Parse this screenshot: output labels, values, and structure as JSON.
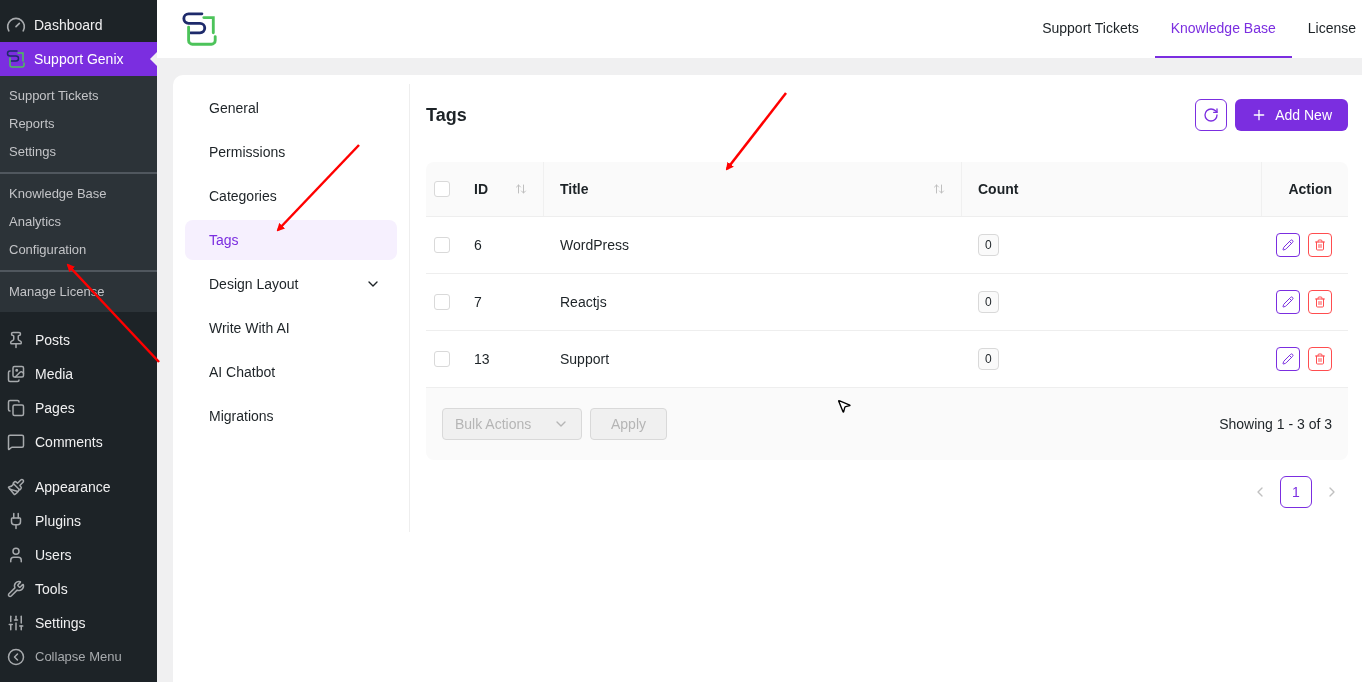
{
  "sidebar": {
    "top": [
      {
        "label": "Dashboard",
        "selected": false
      },
      {
        "label": "Support Genix",
        "selected": true
      }
    ],
    "submenu_groups": [
      [
        {
          "label": "Support Tickets"
        },
        {
          "label": "Reports"
        },
        {
          "label": "Settings"
        }
      ],
      [
        {
          "label": "Knowledge Base"
        },
        {
          "label": "Analytics"
        },
        {
          "label": "Configuration"
        }
      ],
      [
        {
          "label": "Manage License"
        }
      ]
    ],
    "menu_groups": [
      [
        {
          "label": "Posts"
        },
        {
          "label": "Media"
        },
        {
          "label": "Pages"
        },
        {
          "label": "Comments"
        }
      ],
      [
        {
          "label": "Appearance"
        },
        {
          "label": "Plugins"
        },
        {
          "label": "Users"
        },
        {
          "label": "Tools"
        },
        {
          "label": "Settings"
        }
      ]
    ],
    "collapse": "Collapse Menu"
  },
  "header": {
    "tabs": [
      {
        "label": "Support Tickets",
        "selected": false
      },
      {
        "label": "Knowledge Base",
        "selected": true
      },
      {
        "label": "License",
        "selected": false
      }
    ]
  },
  "settings_nav": [
    {
      "label": "General",
      "selected": false,
      "kind": "link"
    },
    {
      "label": "Permissions",
      "selected": false,
      "kind": "link"
    },
    {
      "label": "Categories",
      "selected": false,
      "kind": "link"
    },
    {
      "label": "Tags",
      "selected": true,
      "kind": "link"
    },
    {
      "label": "Design Layout",
      "selected": false,
      "kind": "dropdown"
    },
    {
      "label": "Write With AI",
      "selected": false,
      "kind": "link"
    },
    {
      "label": "AI Chatbot",
      "selected": false,
      "kind": "link"
    },
    {
      "label": "Migrations",
      "selected": false,
      "kind": "link"
    }
  ],
  "page": {
    "title": "Tags",
    "add_button": "Add New"
  },
  "table": {
    "select_all_checked": false,
    "columns": [
      {
        "label": "ID",
        "sortable": true
      },
      {
        "label": "Title",
        "sortable": true
      },
      {
        "label": "Count",
        "sortable": false
      },
      {
        "label": "Action",
        "sortable": false
      }
    ],
    "rows": [
      {
        "checked": false,
        "id": "6",
        "title": "WordPress",
        "count": "0"
      },
      {
        "checked": false,
        "id": "7",
        "title": "Reactjs",
        "count": "0"
      },
      {
        "checked": false,
        "id": "13",
        "title": "Support",
        "count": "0"
      }
    ]
  },
  "footer": {
    "bulk_actions": {
      "placeholder": "Bulk Actions",
      "disabled": true
    },
    "apply": {
      "label": "Apply",
      "disabled": true
    },
    "showing": "Showing 1 - 3 of 3"
  },
  "pagination": {
    "pages": [
      {
        "label": "1",
        "selected": true
      }
    ]
  }
}
